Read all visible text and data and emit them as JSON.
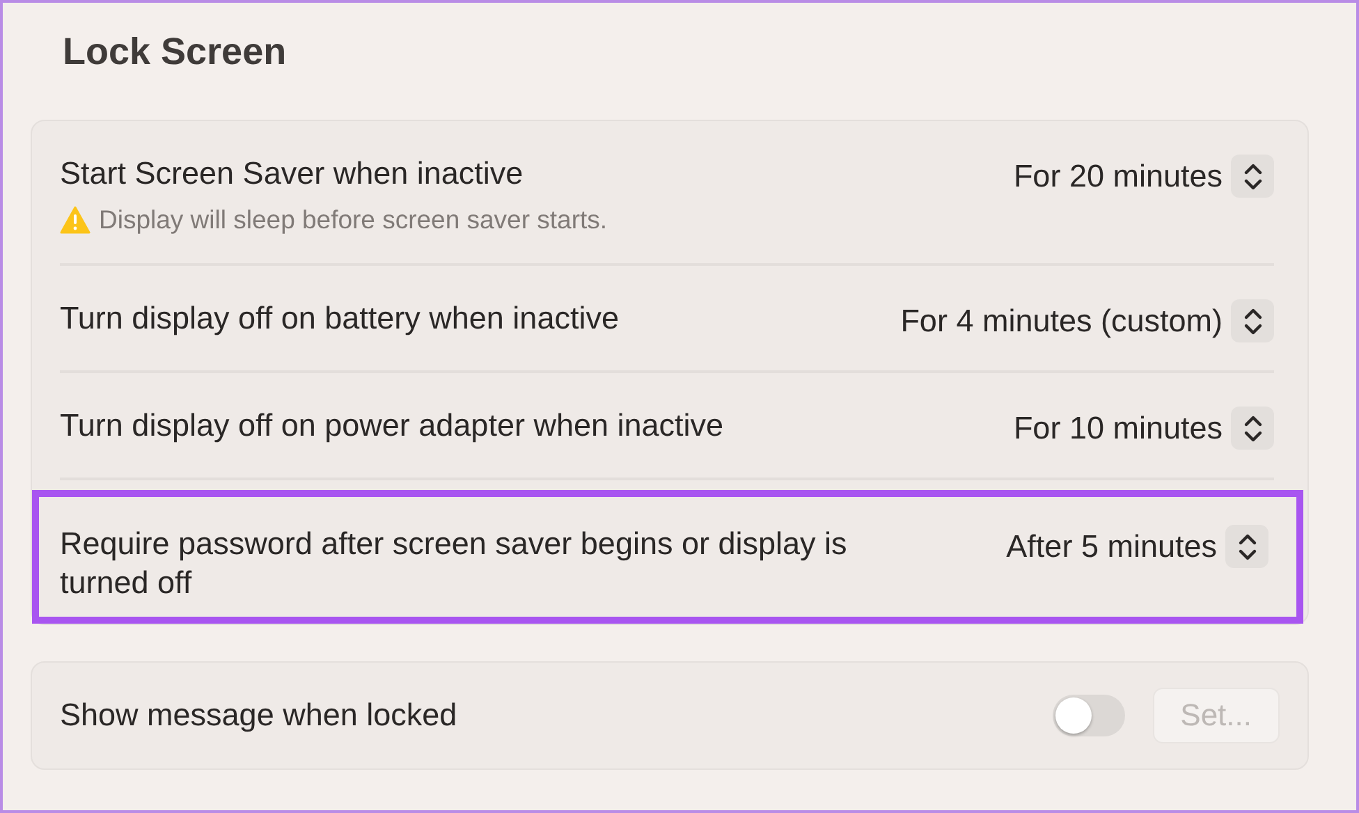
{
  "section_title": "Lock Screen",
  "settings": [
    {
      "label": "Start Screen Saver when inactive",
      "note": "Display will sleep before screen saver starts.",
      "value": "For 20 minutes",
      "highlighted": false
    },
    {
      "label": "Turn display off on battery when inactive",
      "value": "For 4 minutes (custom)",
      "highlighted": false
    },
    {
      "label": "Turn display off on power adapter when inactive",
      "value": "For 10 minutes",
      "highlighted": false
    },
    {
      "label": "Require password after screen saver begins or display is turned off",
      "value": "After 5 minutes",
      "highlighted": true
    }
  ],
  "message": {
    "label": "Show message when locked",
    "on": false,
    "button": {
      "label": "Set...",
      "disabled": true
    }
  }
}
